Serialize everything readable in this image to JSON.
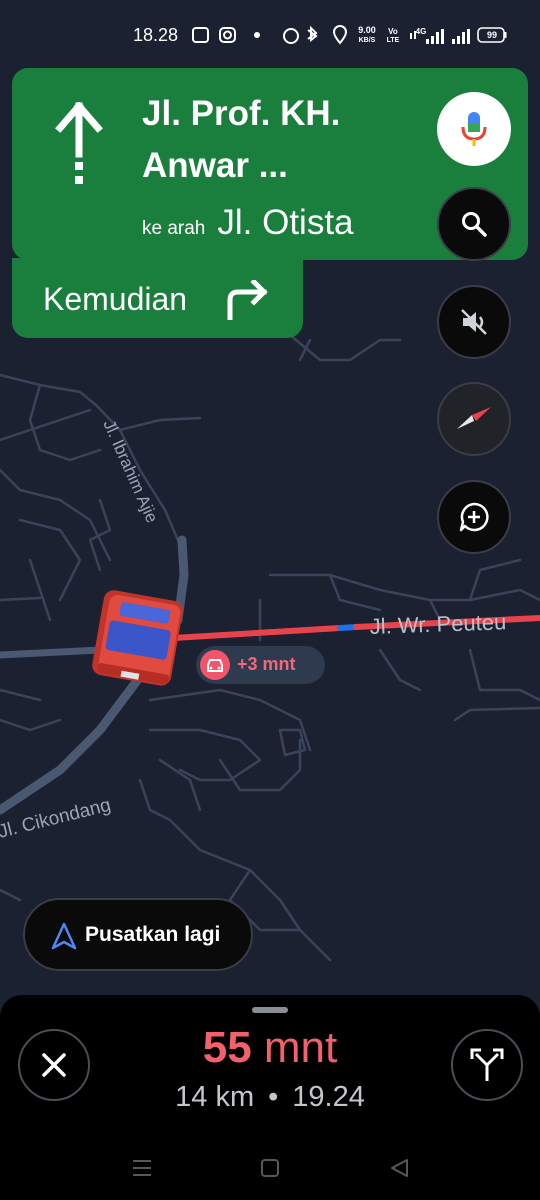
{
  "status_bar": {
    "time": "18.28",
    "net_speed_value": "9.00",
    "net_speed_unit": "KB/S",
    "volte_top": "Vo",
    "volte_bottom": "LTE",
    "network_type": "4G",
    "battery": "99",
    "icons": [
      "capcut-icon",
      "instagram-icon",
      "dot-icon",
      "alarm-icon",
      "bluetooth-icon",
      "location-icon",
      "wifi-icon",
      "signal-icon",
      "battery-icon"
    ]
  },
  "navigation": {
    "maneuver_icon": "straight-arrow-icon",
    "street": "Jl. Prof. KH. Anwar ...",
    "toward_prefix": "ke arah",
    "toward_street": "Jl. Otista",
    "then_label": "Kemudian",
    "then_icon": "turn-right-icon"
  },
  "map": {
    "street_labels": [
      "Jl. Ibrahim Ajie",
      "Jl. Wr. Peuteu",
      "Jl. Cikondang"
    ],
    "traffic_delay": "+3 mnt",
    "recenter_label": "Pusatkan lagi"
  },
  "trip": {
    "duration_value": "55",
    "duration_unit": "mnt",
    "distance": "14 km",
    "separator": "•",
    "arrival_time": "19.24"
  },
  "colors": {
    "banner_green": "#1a7f3c",
    "map_background": "#1b2130",
    "route_traffic_red": "#e8434a",
    "route_blue": "#1a73e8",
    "duration_red": "#f2606c"
  }
}
